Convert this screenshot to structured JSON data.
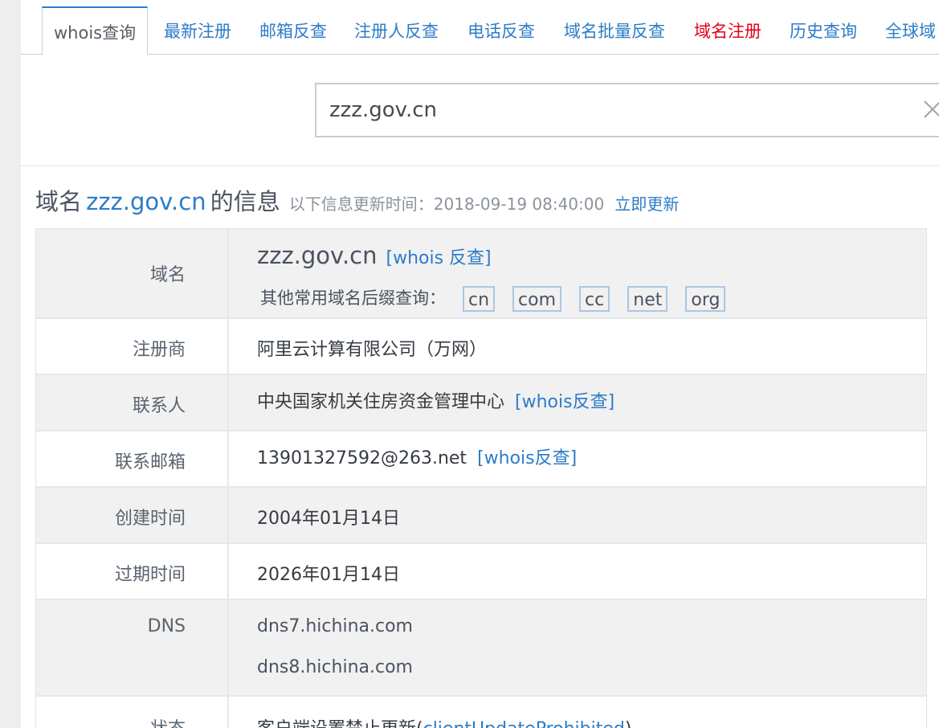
{
  "tabs": [
    {
      "label": "whois查询",
      "active": true
    },
    {
      "label": "最新注册"
    },
    {
      "label": "邮箱反查"
    },
    {
      "label": "注册人反查"
    },
    {
      "label": "电话反查"
    },
    {
      "label": "域名批量反查"
    },
    {
      "label": "域名注册",
      "color": "#e4001b"
    },
    {
      "label": "历史查询"
    },
    {
      "label": "全球域"
    }
  ],
  "search": {
    "value": "zzz.gov.cn",
    "clear_icon": "close-icon"
  },
  "heading": {
    "prefix": "域名",
    "domain": "zzz.gov.cn",
    "suffix": "的信息",
    "update_text": "以下信息更新时间：2018-09-19 08:40:00",
    "refresh_link": "立即更新"
  },
  "info": {
    "domain": {
      "label": "域名",
      "value": "zzz.gov.cn",
      "reverse_link": "[whois 反查]",
      "suffix_prompt": "其他常用域名后缀查询：",
      "suffixes": [
        "cn",
        "com",
        "cc",
        "net",
        "org"
      ]
    },
    "registrar": {
      "label": "注册商",
      "value": "阿里云计算有限公司（万网）"
    },
    "contact": {
      "label": "联系人",
      "value": "中央国家机关住房资金管理中心",
      "reverse_link": "[whois反查]"
    },
    "email": {
      "label": "联系邮箱",
      "value": "13901327592@263.net",
      "reverse_link": "[whois反查]"
    },
    "created": {
      "label": "创建时间",
      "value": "2004年01月14日"
    },
    "expires": {
      "label": "过期时间",
      "value": "2026年01月14日"
    },
    "dns": {
      "label": "DNS",
      "servers": [
        "dns7.hichina.com",
        "dns8.hichina.com"
      ]
    },
    "status": {
      "label": "状态",
      "value_text": "客户端设置禁止更新(",
      "value_link": "clientUpdateProhibited",
      "value_close": ")"
    }
  },
  "colors": {
    "accent": "#2d7cc7",
    "highlight_tab": "#e4001b",
    "row_gray": "#f1f1f1"
  }
}
